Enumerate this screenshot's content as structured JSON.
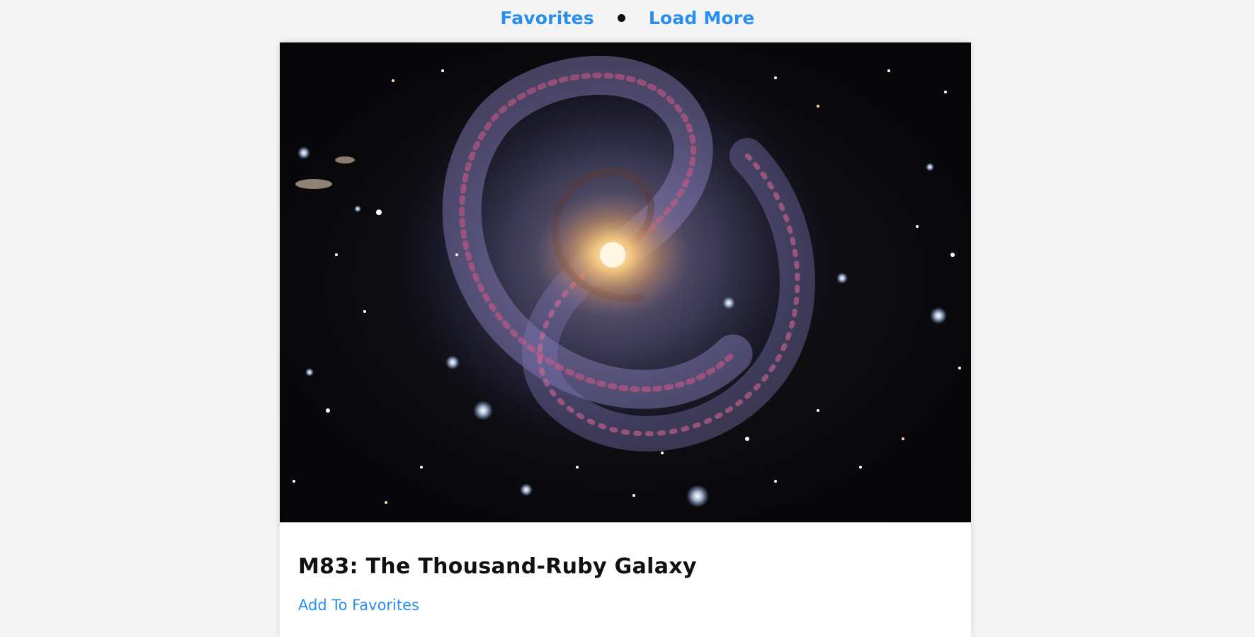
{
  "nav": {
    "favorites_label": "Favorites",
    "load_more_label": "Load More"
  },
  "card": {
    "title": "M83: The Thousand-Ruby Galaxy",
    "add_favorite_label": "Add To Favorites"
  },
  "colors": {
    "link": "#2a8eef",
    "background": "#f4f4f4",
    "card": "#ffffff",
    "title": "#111111"
  }
}
